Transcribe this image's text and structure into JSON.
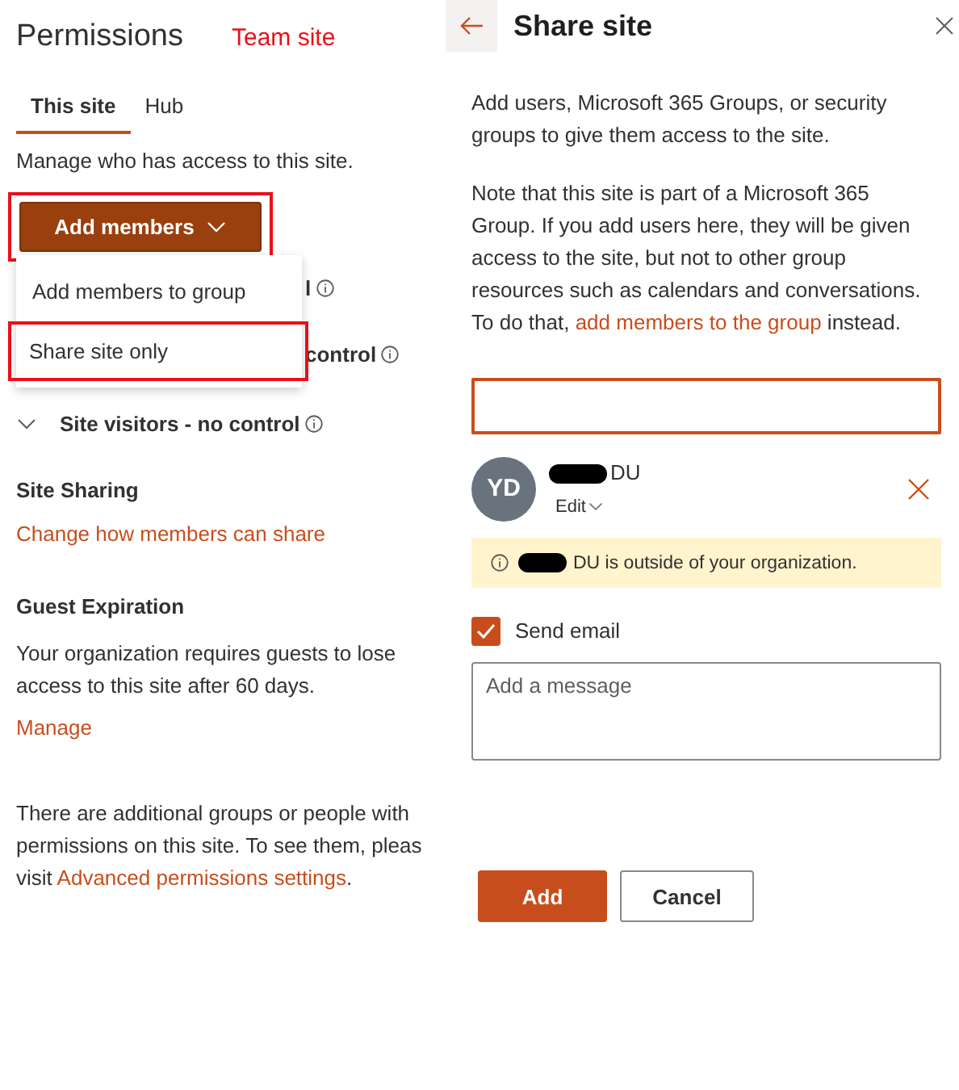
{
  "permissions": {
    "title": "Permissions",
    "site_label": "Team site",
    "tabs": [
      {
        "label": "This site",
        "selected": true
      },
      {
        "label": "Hub",
        "selected": false
      }
    ],
    "intro": "Manage who has access to this site.",
    "add_button": {
      "label": "Add members",
      "highlighted": true
    },
    "menu": [
      {
        "label": "Add members to group",
        "highlighted": false
      },
      {
        "label": "Share site only",
        "highlighted": true
      }
    ],
    "covered_groups": [
      {
        "visible_text": "l"
      },
      {
        "visible_text": "control"
      }
    ],
    "visitors_group": {
      "label": "Site visitors - no control",
      "expanded": false
    },
    "site_sharing": {
      "heading": "Site Sharing",
      "link": "Change how members can share"
    },
    "guest_expiration": {
      "heading": "Guest Expiration",
      "text": "Your organization requires guests to lose access to this site after 60 days.",
      "link": "Manage"
    },
    "footer": {
      "text": "There are additional groups or people with\npermissions on this site. To see them, pleas\nvisit ",
      "link": "Advanced permissions settings",
      "end": "."
    }
  },
  "share": {
    "title": "Share site",
    "description": "Add users, Microsoft 365 Groups, or security groups to give them access to the site.",
    "note": "Note that this site is part of a Microsoft 365 Group. If you add users here, they will be given access to the site, but not to other group resources such as calendars and conversations. To do that, ",
    "note_link": "add members to the group",
    "note_end": " instead.",
    "person": {
      "initials": "YD",
      "name": "DU",
      "permission": "Edit"
    },
    "warning": "DU is outside of your organization.",
    "send_email": {
      "label": "Send email",
      "checked": true
    },
    "message": {
      "placeholder": "Add a message"
    },
    "buttons": [
      {
        "label": "Add",
        "kind": "primary"
      },
      {
        "label": "Cancel",
        "kind": "secondary"
      }
    ]
  }
}
